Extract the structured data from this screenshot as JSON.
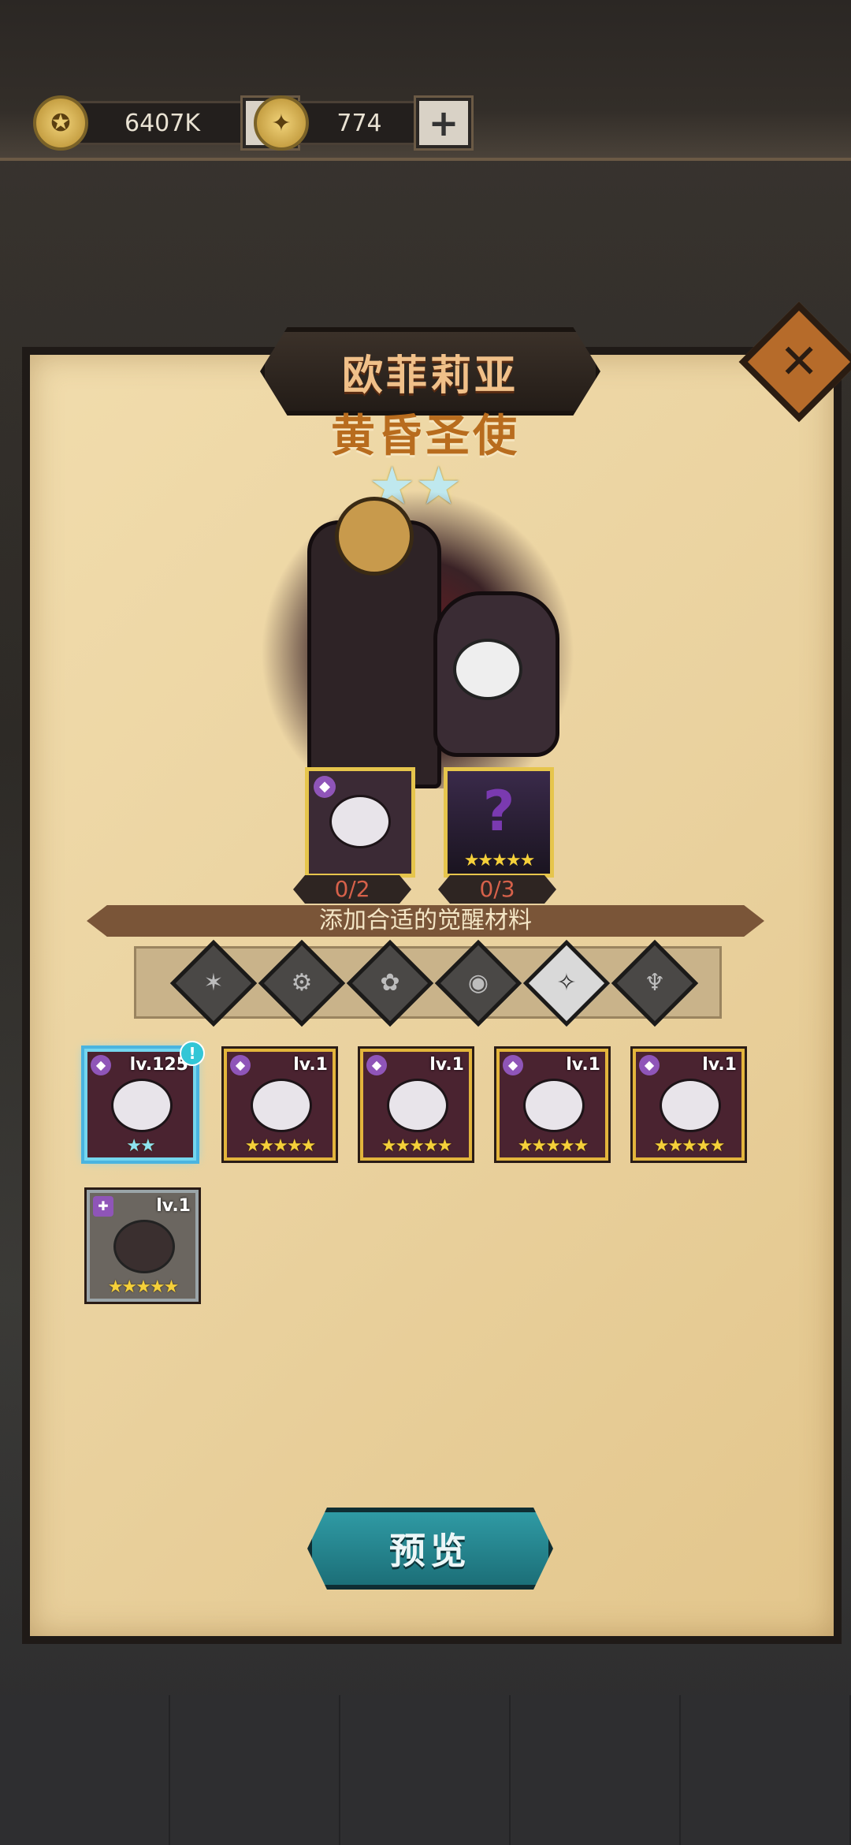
{
  "resources": [
    {
      "icon": "gold-coin-icon",
      "value": "6407K",
      "plus": "+"
    },
    {
      "icon": "gem-icon",
      "value": "774",
      "plus": "+"
    }
  ],
  "dialog": {
    "name": "欧菲莉亚",
    "title": "黄昏圣使",
    "star_count": 2,
    "stars_display": "★★",
    "close_glyph": "✕"
  },
  "material_slots": [
    {
      "count": "0/2",
      "stars": ""
    },
    {
      "count": "0/3",
      "stars": "★★★★★",
      "placeholder": "?"
    }
  ],
  "ribbon_text": "添加合适的觉醒材料",
  "faction_filters": [
    "all",
    "faction-1",
    "faction-2",
    "faction-3",
    "faction-4",
    "faction-5"
  ],
  "filter_glyphs": [
    "✶",
    "⚙",
    "✿",
    "◉",
    "✧",
    "♆"
  ],
  "cards": [
    {
      "level": "lv.125",
      "stars": "★★",
      "selected": true,
      "alert": "!"
    },
    {
      "level": "lv.1",
      "stars": "★★★★★"
    },
    {
      "level": "lv.1",
      "stars": "★★★★★"
    },
    {
      "level": "lv.1",
      "stars": "★★★★★"
    },
    {
      "level": "lv.1",
      "stars": "★★★★★"
    },
    {
      "level": "lv.1",
      "stars": "★★★★★",
      "generic": true
    }
  ],
  "preview_button": "预览",
  "colors": {
    "accent_gold": "#e3b53c",
    "teal_button": "#2f9aa4",
    "parchment": "#ead29f"
  }
}
